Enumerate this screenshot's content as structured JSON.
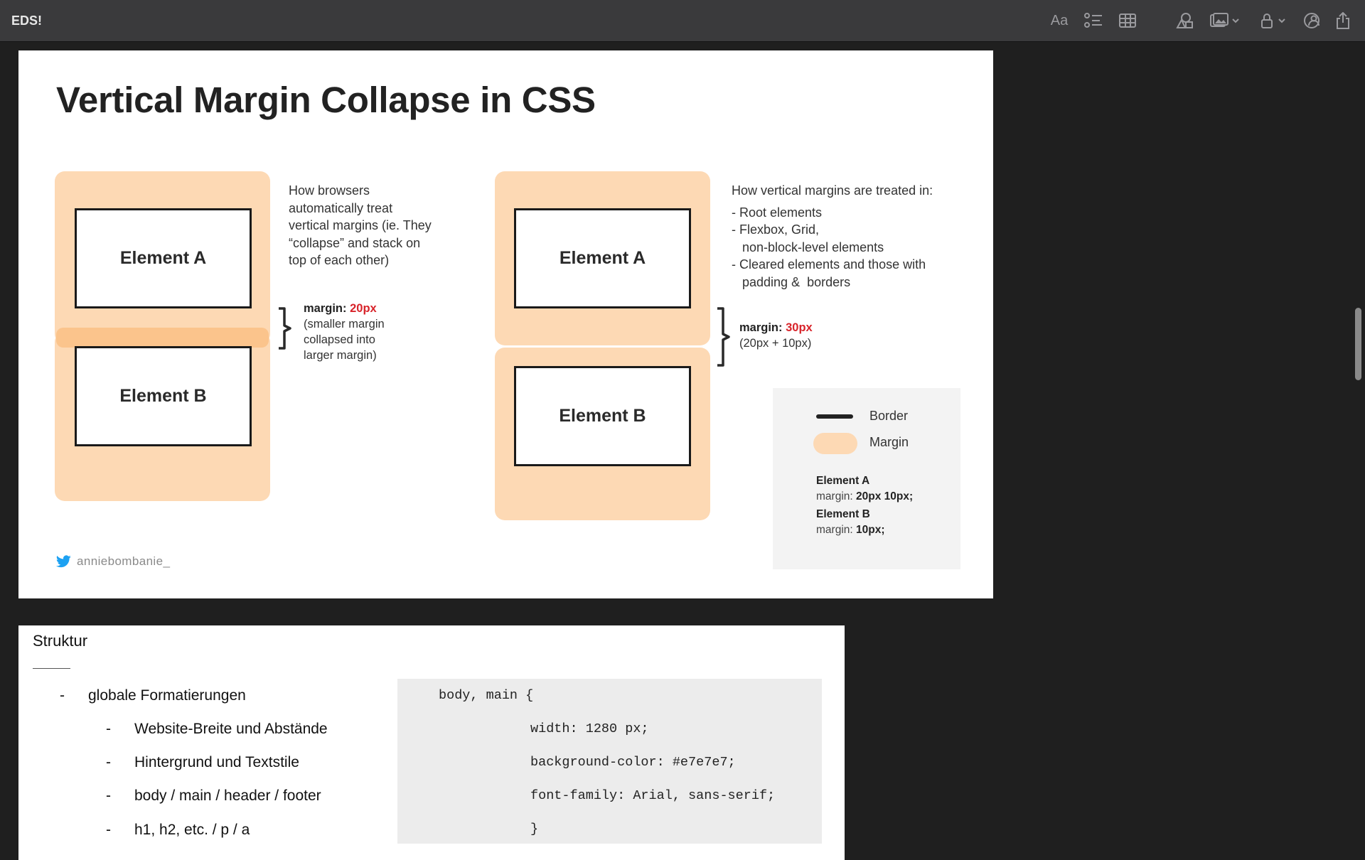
{
  "app": {
    "title": "EDS!"
  },
  "toolbar": {
    "icons": [
      "text-format-icon",
      "checklist-icon",
      "table-icon",
      "collaborate-icon",
      "media-icon",
      "lock-icon",
      "share-with-people-icon",
      "export-icon"
    ],
    "format_label": "Aa"
  },
  "slide": {
    "title": "Vertical Margin Collapse in CSS",
    "left_diagram": {
      "element_a": "Element A",
      "element_b": "Element B",
      "explanation": [
        "How browsers",
        "automatically treat",
        "vertical margins (ie. They",
        "“collapse” and stack on",
        "top of each other)"
      ],
      "margin_label": "margin:",
      "margin_value": "20px",
      "margin_note": [
        "(smaller margin",
        "collapsed into",
        "larger margin)"
      ]
    },
    "right_diagram": {
      "element_a": "Element A",
      "element_b": "Element B",
      "heading": "How vertical margins are treated in:",
      "items": [
        "- Root elements",
        "- Flexbox, Grid,",
        "   non-block-level elements",
        "- Cleared elements and those with",
        "   padding &  borders"
      ],
      "margin_label": "margin:",
      "margin_value": "30px",
      "margin_note": "(20px + 10px)"
    },
    "legend": {
      "border_label": "Border",
      "margin_label": "Margin",
      "element_a_title": "Element A",
      "element_a_prefix": "margin: ",
      "element_a_value": "20px 10px;",
      "element_b_title": "Element B",
      "element_b_prefix": "margin: ",
      "element_b_value": "10px;"
    },
    "credit": "anniebombanie_",
    "colors": {
      "margin": "#fdd9b4",
      "collapsed_margin": "#fbc48c",
      "highlight": "#d8232a",
      "twitter": "#1da1f2"
    }
  },
  "notes": {
    "heading": "Struktur",
    "bullets": [
      {
        "dash": "-",
        "text": "globale Formatierungen"
      },
      {
        "dash": "-",
        "text": "Website-Breite und Abstände"
      },
      {
        "dash": "-",
        "text": "Hintergrund und Textstile"
      },
      {
        "dash": "-",
        "text": "body / main / header / footer"
      },
      {
        "dash": "-",
        "text": "h1, h2, etc. / p / a"
      }
    ],
    "code": [
      "body, main {",
      "width: 1280 px;",
      "background-color: #e7e7e7;",
      "font-family: Arial, sans-serif;",
      "}"
    ]
  }
}
